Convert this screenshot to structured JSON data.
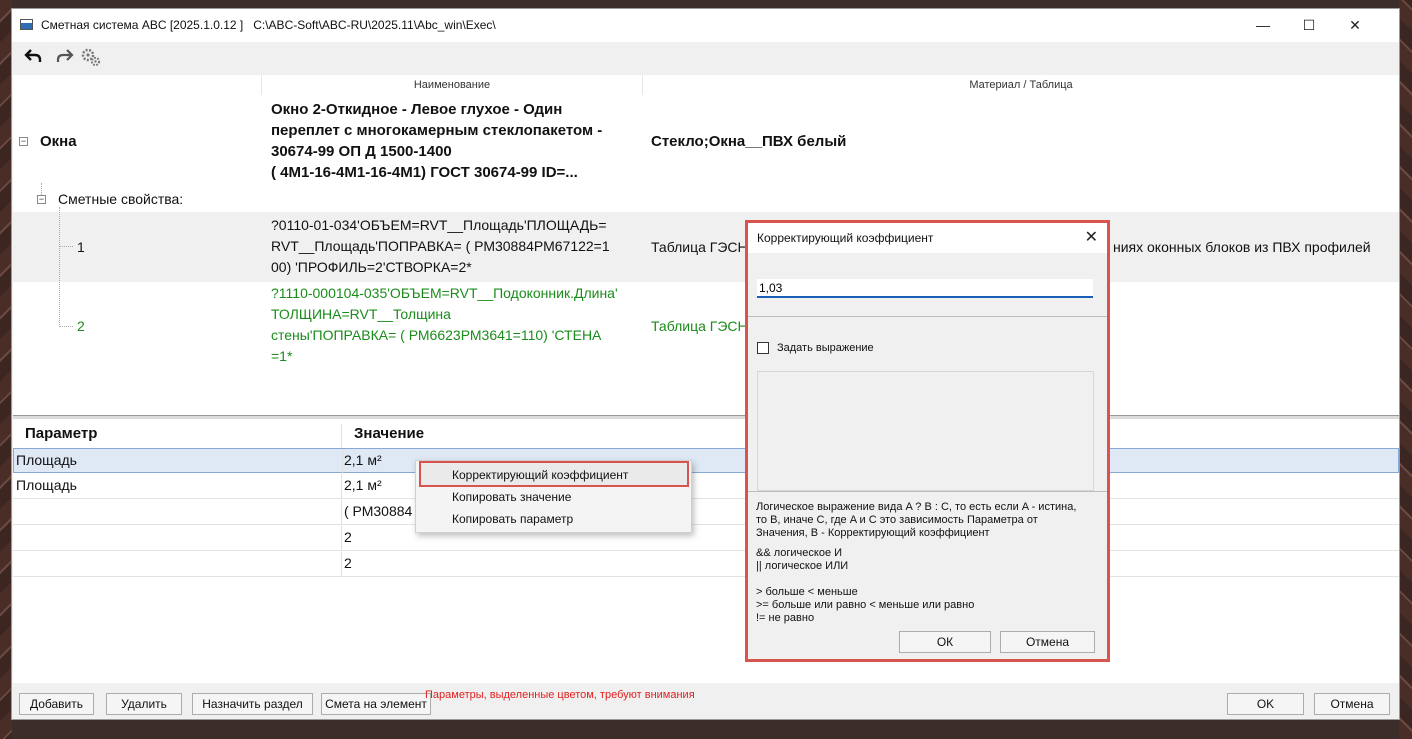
{
  "window": {
    "title": "Сметная система ABC [2025.1.0.12 ]   C:\\ABC-Soft\\ABC-RU\\2025.11\\Abc_win\\Exec\\",
    "minimize": "—",
    "maximize": "☐",
    "close": "✕"
  },
  "toolbar": {
    "undo_icon": "undo-arrow-icon",
    "redo_icon": "redo-arrow-icon",
    "settings_icon": "gears-icon"
  },
  "tree": {
    "columns": [
      "Наименование",
      "Материал / Таблица"
    ],
    "root": {
      "label": "Окна",
      "name_lines": [
        "Окно 2-Откидное - Левое глухое - Один",
        "переплет с многокамерным стеклопакетом -",
        "30674-99 ОП Д  1500-1400",
        "  ( 4М1-16-4М1-16-4М1)     ГОСТ 30674-99  ID=..."
      ],
      "material": "Стекло;Окна__ПВХ белый"
    },
    "group_label": "Сметные свойства:",
    "rows": [
      {
        "index": "1",
        "name_lines": [
          "?0110-01-034'ОБЪЕМ=RVT__Площадь'ПЛОЩАДЬ=",
          "RVT__Площадь'ПОПРАВКА= ( РМ30884РМ67122=1",
          "00)   'ПРОФИЛЬ=2'СТВОРКА=2*"
        ],
        "table": "Таблица ГЭСН",
        "table_tail": "ниях оконных блоков из ПВХ профилей"
      },
      {
        "index": "2",
        "name_lines": [
          "?1110-000104-035'ОБЪЕМ=RVT__Подоконник.Длина'",
          "ТОЛЩИНА=RVT__Толщина",
          "стены'ПОПРАВКА= ( РМ6623РМ3641=110)   'СТЕНА",
          "=1*"
        ],
        "table": "Таблица ГЭСН"
      }
    ]
  },
  "params": {
    "header_param": "Параметр",
    "header_value": "Значение",
    "rows": [
      {
        "param": "Площадь",
        "value": "2,1  м²"
      },
      {
        "param": "Площадь",
        "value": "2,1  м²"
      },
      {
        "param": "",
        "value": " ( РМ30884"
      },
      {
        "param": "",
        "value": "2"
      },
      {
        "param": "",
        "value": "2"
      }
    ]
  },
  "context_menu": {
    "items": [
      "Корректирующий коэффициент",
      "Копировать значение",
      "Копировать параметр"
    ]
  },
  "dialog": {
    "title": "Корректирующий коэффициент",
    "close": "✕",
    "value": "1,03",
    "checkbox_label": "Задать выражение",
    "help_lines": [
      "Логическое выражение вида A ? B : C, то есть если A  - истина,",
      "то B, иначе С, где A и С это зависимость Параметра от",
      "Значения, B - Корректирующий коэффициент",
      "&& логическое И",
      "|| логическое ИЛИ",
      "> больше  < меньше",
      ">= больше или равно  < меньше или равно",
      "!= не равно"
    ],
    "ok": "ОК",
    "cancel": "Отмена"
  },
  "bottom": {
    "add": "Добавить",
    "delete": "Удалить",
    "assign_section": "Назначить раздел",
    "estimate": "Смета на элемент",
    "warning": "Параметры, выделенные цветом, требуют внимания",
    "ok": "OK",
    "cancel": "Отмена"
  },
  "colors": {
    "accent": "#1a5fb4",
    "highlight": "#d9534f",
    "green": "#1b8c1b",
    "warning": "#e02020"
  }
}
